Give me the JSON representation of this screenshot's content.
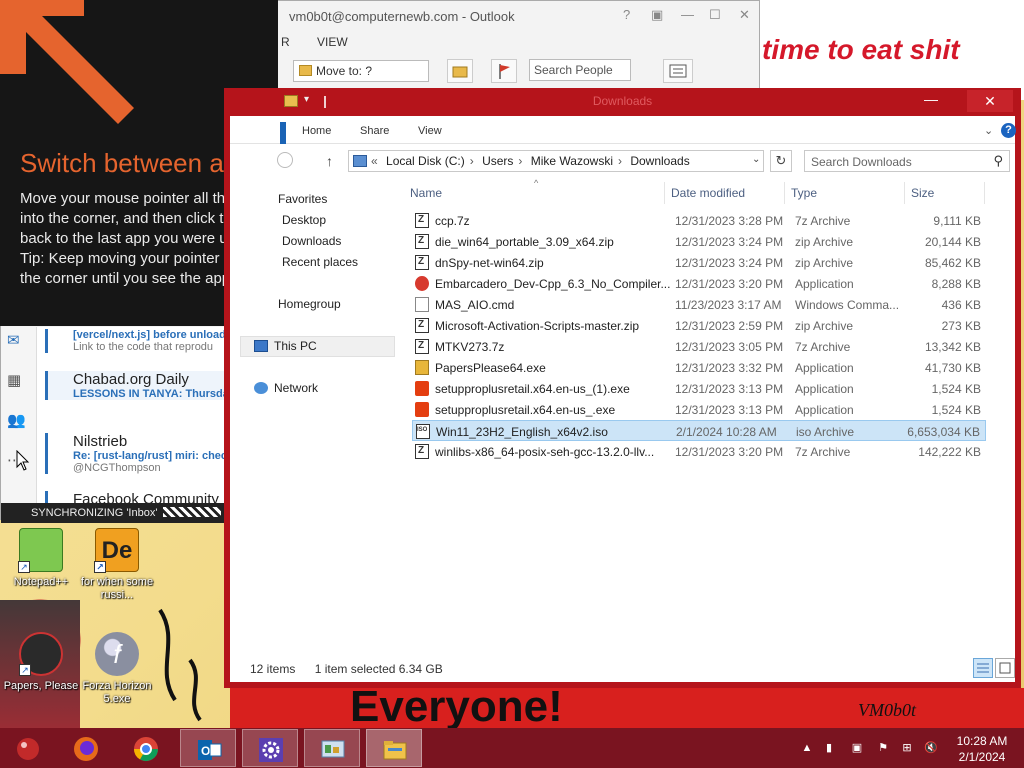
{
  "desktop": {
    "banner_text": "time to eat shit",
    "red_band_text": "Everyone!",
    "red_band_small": "VM0b0t",
    "icons": [
      {
        "label": "Notepad++"
      },
      {
        "label": "for when some russi..."
      },
      {
        "label": "Papers, Please"
      },
      {
        "label": "Forza Horizon 5.exe"
      }
    ]
  },
  "outlook": {
    "title": "vm0b0t@computernewb.com - Outlook",
    "controls": [
      "?",
      "▣",
      "—",
      "☐",
      "✕"
    ],
    "menu": [
      "R",
      "VIEW"
    ],
    "move_to": "Move to: ?",
    "search_people": "Search People",
    "mails": [
      {
        "from": "",
        "subject": "[vercel/next.js] before unload",
        "preview": "Link to the code that reprodu"
      },
      {
        "from": "Chabad.org Daily",
        "subject": "LESSONS IN TANYA: Thursda",
        "preview": ""
      },
      {
        "from": "Nilstrieb",
        "subject": "Re: [rust-lang/rust] miri: chec",
        "preview": "@NCGThompson"
      },
      {
        "from": "Facebook Community",
        "subject": "",
        "preview": ""
      }
    ],
    "status": "SYNCHRONIZING 'Inbox'"
  },
  "tip": {
    "title": "Switch between apps",
    "body": "Move your mouse pointer all the way into the corner, and then click to go back to the last app you were using.",
    "tip": "Tip: Keep moving your pointer into the corner until you see the app."
  },
  "explorer": {
    "title": "Downloads",
    "ribbon_tabs": [
      "Home",
      "Share",
      "View"
    ],
    "breadcrumb": [
      "Local Disk (C:)",
      "Users",
      "Mike Wazowski",
      "Downloads"
    ],
    "search_placeholder": "Search Downloads",
    "nav": {
      "favorites": "Favorites",
      "items": [
        "Desktop",
        "Downloads",
        "Recent places"
      ],
      "homegroup": "Homegroup",
      "this_pc": "This PC",
      "network": "Network"
    },
    "columns": [
      "Name",
      "Date modified",
      "Type",
      "Size"
    ],
    "files": [
      {
        "name": "ccp.7z",
        "date": "12/31/2023 3:28 PM",
        "type": "7z Archive",
        "size": "9,111 KB",
        "icon": "archive-icon"
      },
      {
        "name": "die_win64_portable_3.09_x64.zip",
        "date": "12/31/2023 3:24 PM",
        "type": "zip Archive",
        "size": "20,144 KB",
        "icon": "archive-icon"
      },
      {
        "name": "dnSpy-net-win64.zip",
        "date": "12/31/2023 3:24 PM",
        "type": "zip Archive",
        "size": "85,462 KB",
        "icon": "archive-icon"
      },
      {
        "name": "Embarcadero_Dev-Cpp_6.3_No_Compiler...",
        "date": "12/31/2023 3:20 PM",
        "type": "Application",
        "size": "8,288 KB",
        "icon": "devcpp-icon"
      },
      {
        "name": "MAS_AIO.cmd",
        "date": "11/23/2023 3:17 AM",
        "type": "Windows Comma...",
        "size": "436 KB",
        "icon": "cmd-file-icon"
      },
      {
        "name": "Microsoft-Activation-Scripts-master.zip",
        "date": "12/31/2023 2:59 PM",
        "type": "zip Archive",
        "size": "273 KB",
        "icon": "archive-icon"
      },
      {
        "name": "MTKV273.7z",
        "date": "12/31/2023 3:05 PM",
        "type": "7z Archive",
        "size": "13,342 KB",
        "icon": "archive-icon"
      },
      {
        "name": "PapersPlease64.exe",
        "date": "12/31/2023 3:32 PM",
        "type": "Application",
        "size": "41,730 KB",
        "icon": "papers-please-icon"
      },
      {
        "name": "setupproplusretail.x64.en-us_(1).exe",
        "date": "12/31/2023 3:13 PM",
        "type": "Application",
        "size": "1,524 KB",
        "icon": "office-icon"
      },
      {
        "name": "setupproplusretail.x64.en-us_.exe",
        "date": "12/31/2023 3:13 PM",
        "type": "Application",
        "size": "1,524 KB",
        "icon": "office-icon"
      },
      {
        "name": "Win11_23H2_English_x64v2.iso",
        "date": "2/1/2024 10:28 AM",
        "type": "iso Archive",
        "size": "6,653,034 KB",
        "icon": "iso-icon",
        "selected": true
      },
      {
        "name": "winlibs-x86_64-posix-seh-gcc-13.2.0-llv...",
        "date": "12/31/2023 3:20 PM",
        "type": "7z Archive",
        "size": "142,222 KB",
        "icon": "archive-icon"
      }
    ],
    "status_items": "12 items",
    "status_selected": "1 item selected  6.34 GB"
  },
  "taskbar": {
    "apps": [
      "start-orb",
      "firefox",
      "chrome",
      "outlook",
      "settings",
      "control-panel",
      "file-explorer"
    ],
    "time": "10:28 AM",
    "date": "2/1/2024"
  },
  "colors": {
    "window_frame": "#b5141b",
    "taskbar": "#7a1420",
    "tip_accent": "#e5642e",
    "selection": "#cce4f7"
  }
}
